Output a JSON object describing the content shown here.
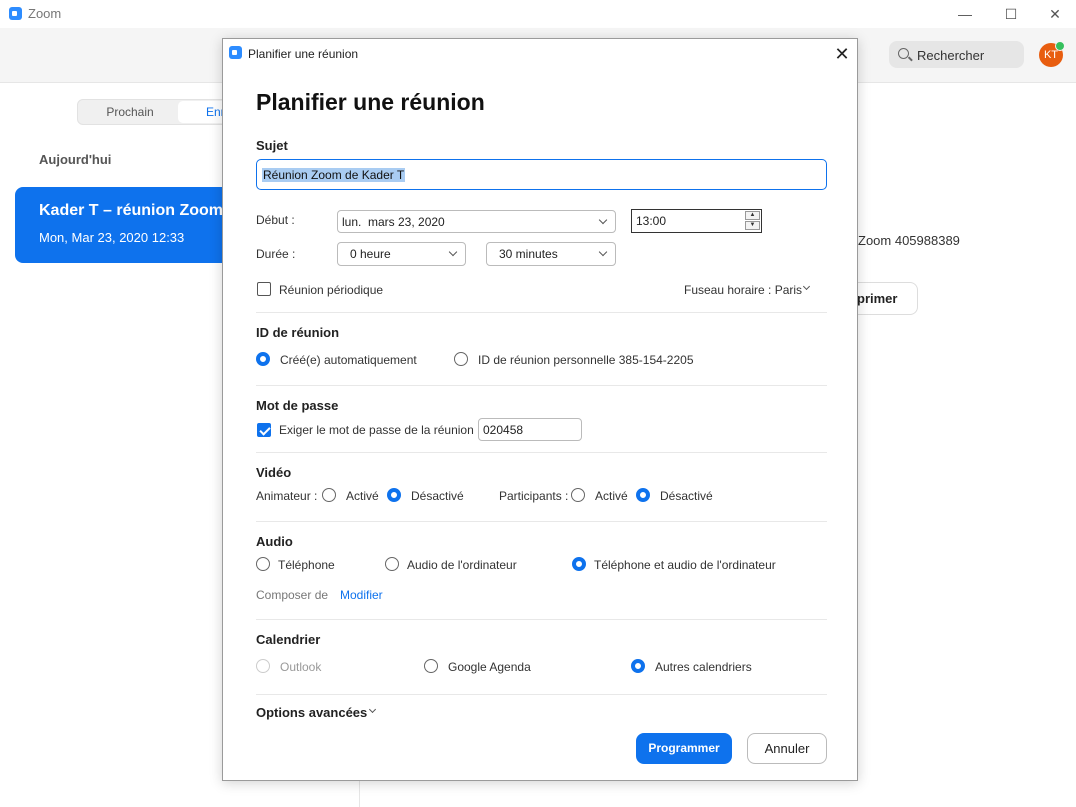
{
  "window": {
    "app_title": "Zoom",
    "minimize": "—",
    "maximize": "☐",
    "close": "✕"
  },
  "toolbar": {
    "search_label": "Rechercher",
    "avatar_initials": "KT"
  },
  "meetings_pane": {
    "tab_upcoming": "Prochain",
    "tab_recorded": "Enr",
    "today_label": "Aujourd'hui",
    "meeting_title": "Kader T – réunion Zoom",
    "meeting_datetime": "Mon, Mar 23, 2020 12:33"
  },
  "details_pane": {
    "meeting_id_text": "Zoom 405988389",
    "delete_button": "primer"
  },
  "dialog": {
    "window_title": "Planifier une réunion",
    "close_glyph": "✕",
    "heading": "Planifier une réunion",
    "topic": {
      "label": "Sujet",
      "value": "Réunion Zoom de Kader T"
    },
    "start": {
      "label": "Début :",
      "day": "lun.",
      "date": "mars 23, 2020",
      "time": "13:00"
    },
    "duration": {
      "label": "Durée :",
      "hours": "0 heure",
      "minutes": "30 minutes"
    },
    "recurring_label": "Réunion périodique",
    "recurring_checked": false,
    "timezone": "Fuseau horaire : Paris",
    "meeting_id": {
      "title": "ID de réunion",
      "auto": "Créé(e) automatiquement",
      "personal": "ID de réunion personnelle 385-154-2205",
      "selected": "auto"
    },
    "password": {
      "title": "Mot de passe",
      "require_label": "Exiger le mot de passe de la réunion",
      "require_checked": true,
      "value": "020458"
    },
    "video": {
      "title": "Vidéo",
      "host_label": "Animateur :",
      "participants_label": "Participants :",
      "on": "Activé",
      "off": "Désactivé",
      "host_selected": "off",
      "participants_selected": "off"
    },
    "audio": {
      "title": "Audio",
      "phone": "Téléphone",
      "computer": "Audio de l'ordinateur",
      "both": "Téléphone et audio de l'ordinateur",
      "selected": "both",
      "dial_from_label": "Composer de",
      "edit_link": "Modifier"
    },
    "calendar": {
      "title": "Calendrier",
      "outlook": "Outlook",
      "google": "Google Agenda",
      "other": "Autres calendriers",
      "selected": "other"
    },
    "advanced_options": "Options avancées",
    "schedule_button": "Programmer",
    "cancel_button": "Annuler"
  },
  "colors": {
    "accent": "#0e72ed",
    "avatar": "#e85d0f",
    "status_online": "#36c05d"
  }
}
